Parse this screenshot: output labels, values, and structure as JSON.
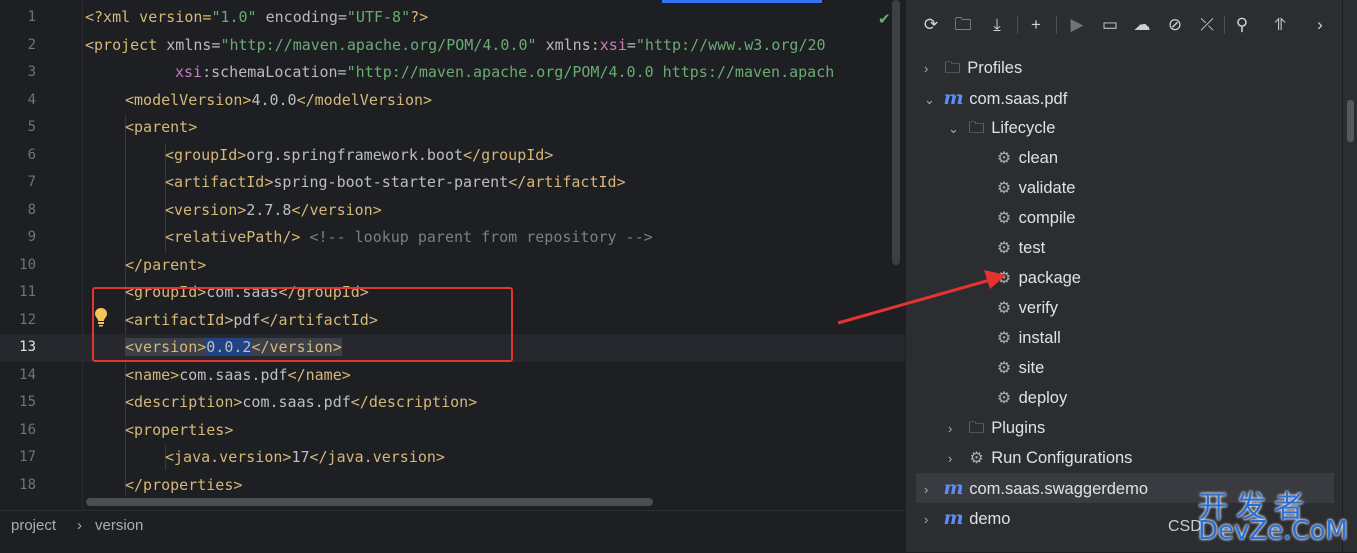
{
  "editor": {
    "lines": [
      {
        "n": "1"
      },
      {
        "n": "2"
      },
      {
        "n": "3"
      },
      {
        "n": "4"
      },
      {
        "n": "5"
      },
      {
        "n": "6"
      },
      {
        "n": "7"
      },
      {
        "n": "8"
      },
      {
        "n": "9"
      },
      {
        "n": "10"
      },
      {
        "n": "11"
      },
      {
        "n": "12"
      },
      {
        "n": "13"
      },
      {
        "n": "14"
      },
      {
        "n": "15"
      },
      {
        "n": "16"
      },
      {
        "n": "17"
      },
      {
        "n": "18"
      }
    ],
    "code": {
      "l1_a": "<?xml version=",
      "l1_b": "\"1.0\"",
      "l1_c": " encoding=",
      "l1_d": "\"UTF-8\"",
      "l1_e": "?>",
      "l2_a": "<project ",
      "l2_b": "xmlns=",
      "l2_c": "\"http://maven.apache.org/POM/4.0.0\"",
      "l2_d": " xmlns:",
      "l2_e": "xsi",
      "l2_f": "=",
      "l2_g": "\"http://www.w3.org/20",
      "l3_a": "xsi",
      "l3_b": ":schemaLocation=",
      "l3_c": "\"http://maven.apache.org/POM/4.0.0 https://maven.apach",
      "l4_a": "<modelVersion>",
      "l4_b": "4.0.0",
      "l4_c": "</modelVersion>",
      "l5_a": "<parent>",
      "l6_a": "<groupId>",
      "l6_b": "org.springframework.boot",
      "l6_c": "</groupId>",
      "l7_a": "<artifactId>",
      "l7_b": "spring-boot-starter-parent",
      "l7_c": "</artifactId>",
      "l8_a": "<version>",
      "l8_b": "2.7.8",
      "l8_c": "</version>",
      "l9_a": "<relativePath/>",
      "l9_b": " <!-- lookup parent from repository -->",
      "l10_a": "</parent>",
      "l11_a": "<groupId>",
      "l11_b": "com.saas",
      "l11_c": "</groupId>",
      "l12_a": "<artifactId>",
      "l12_b": "pdf",
      "l12_c": "</artifactId>",
      "l13_a": "<version>",
      "l13_b": "0.0.2",
      "l13_c": "</version>",
      "l14_a": "<name>",
      "l14_b": "com.saas.pdf",
      "l14_c": "</name>",
      "l15_a": "<description>",
      "l15_b": "com.saas.pdf",
      "l15_c": "</description>",
      "l16_a": "<properties>",
      "l17_a": "<java.version>",
      "l17_b": "17",
      "l17_c": "</java.version>",
      "l18_a": "</properties>"
    }
  },
  "statusbar": {
    "crumb1": "project",
    "sep": "›",
    "crumb2": "version"
  },
  "maven_panel": {
    "toolbar_icons": [
      "reload-icon",
      "reimport-folder-icon",
      "download-icon",
      "add-icon",
      "run-icon",
      "execute-goal-icon",
      "offline-icon",
      "skip-tests-icon",
      "collapse-all-icon",
      "analyze-dependencies-icon",
      "show-dependencies-icon",
      "more-icon"
    ],
    "tree": {
      "profiles": "Profiles",
      "project1": "com.saas.pdf",
      "lifecycle": "Lifecycle",
      "goals": [
        "clean",
        "validate",
        "compile",
        "test",
        "package",
        "verify",
        "install",
        "site",
        "deploy"
      ],
      "plugins": "Plugins",
      "run_configs": "Run Configurations",
      "project2": "com.saas.swaggerdemo",
      "project3": "demo"
    },
    "maven_icon_glyph": "m"
  },
  "watermark": {
    "csd": "CSD",
    "cn": "开发者",
    "en": "DevZe.CoM"
  },
  "colors": {
    "tag": "#d5b778",
    "string": "#6aab73",
    "namespace": "#c77dbb",
    "comment": "#7a7e85",
    "selection": "#214283",
    "annotation": "#e3342f",
    "maven": "#5c8df6"
  }
}
